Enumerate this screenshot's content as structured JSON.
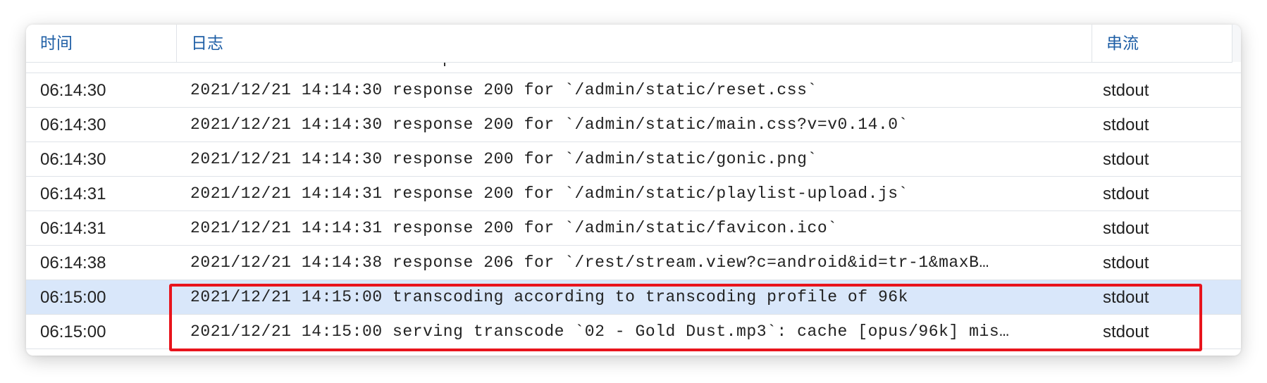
{
  "table": {
    "headers": {
      "time": "时间",
      "log": "日志",
      "stream": "串流"
    },
    "rows": [
      {
        "time": "06:14:30",
        "log": "2021/12/21 14:14:30 response  200  for `/admin/static/reset.css`",
        "stream": "stdout",
        "selected": false
      },
      {
        "time": "06:14:30",
        "log": "2021/12/21 14:14:30 response  200  for `/admin/static/main.css?v=v0.14.0`",
        "stream": "stdout",
        "selected": false
      },
      {
        "time": "06:14:30",
        "log": "2021/12/21 14:14:30 response  200  for `/admin/static/gonic.png`",
        "stream": "stdout",
        "selected": false
      },
      {
        "time": "06:14:31",
        "log": "2021/12/21 14:14:31 response  200  for `/admin/static/playlist-upload.js`",
        "stream": "stdout",
        "selected": false
      },
      {
        "time": "06:14:31",
        "log": "2021/12/21 14:14:31 response  200  for `/admin/static/favicon.ico`",
        "stream": "stdout",
        "selected": false
      },
      {
        "time": "06:14:38",
        "log": "2021/12/21 14:14:38 response  206  for `/rest/stream.view?c=android&id=tr-1&maxB…",
        "stream": "stdout",
        "selected": false
      },
      {
        "time": "06:15:00",
        "log": "2021/12/21 14:15:00 transcoding according to transcoding profile of 96k",
        "stream": "stdout",
        "selected": true
      },
      {
        "time": "06:15:00",
        "log": "2021/12/21 14:15:00 serving transcode `02 - Gold Dust.mp3`: cache [opus/96k] mis…",
        "stream": "stdout",
        "selected": false
      }
    ]
  },
  "colors": {
    "header_text": "#1f5fa6",
    "selected_row": "#d9e7fa",
    "annotation_box": "#e8141c"
  }
}
